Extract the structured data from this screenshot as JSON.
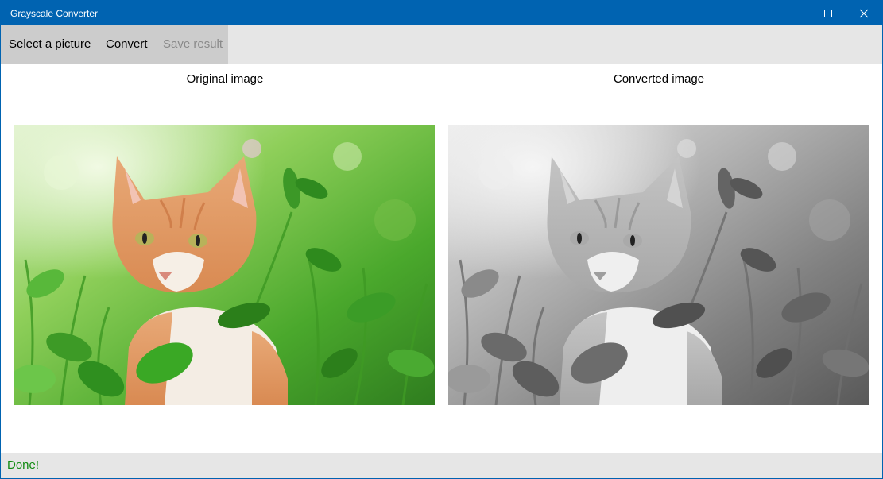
{
  "window": {
    "title": "Grayscale Converter"
  },
  "toolbar": {
    "select_label": "Select a picture",
    "convert_label": "Convert",
    "save_label": "Save result",
    "save_enabled": false
  },
  "panels": {
    "original_caption": "Original image",
    "converted_caption": "Converted image"
  },
  "status": {
    "text": "Done!",
    "color": "#108a10"
  },
  "colors": {
    "titlebar": "#0063b1",
    "commandbar": "#e6e6e6",
    "button_group": "#cccccc",
    "disabled_text": "#8a8a8a"
  },
  "icons": {
    "minimize": "minimize-icon",
    "maximize": "maximize-icon",
    "close": "close-icon"
  }
}
